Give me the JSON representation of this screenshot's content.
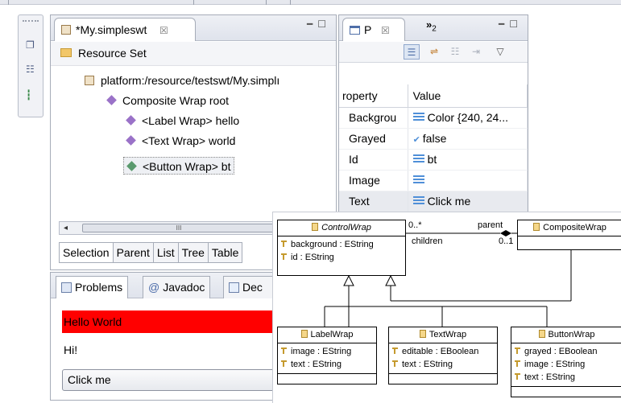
{
  "editor": {
    "tab_title": "*My.simpleswt",
    "close_symbol": "☒",
    "resource_set": "Resource Set",
    "tree": [
      {
        "label": "platform:/resource/testswt/My.simplı"
      },
      {
        "label": "Composite Wrap root"
      },
      {
        "label": "<Label Wrap> hello"
      },
      {
        "label": "<Text Wrap> world"
      },
      {
        "label": "<Button Wrap> bt"
      }
    ],
    "scroll_thumb": "III",
    "bottom_tabs": [
      "Selection",
      "Parent",
      "List",
      "Tree",
      "Table"
    ]
  },
  "properties": {
    "tab_label": "P",
    "close_symbol": "☒",
    "overflow_label": "»",
    "overflow_count": "2",
    "col_property": "roperty",
    "col_value": "Value",
    "rows": [
      {
        "property": "Backgrou",
        "value": "Color {240, 24..."
      },
      {
        "property": "Grayed",
        "value": "false"
      },
      {
        "property": "Id",
        "value": "bt"
      },
      {
        "property": "Image",
        "value": ""
      },
      {
        "property": "Text",
        "value": "Click me"
      }
    ]
  },
  "bottom_view": {
    "tabs": [
      "Problems",
      "Javadoc",
      "Dec"
    ],
    "hello_text": "Hello World",
    "hi_text": "Hi!",
    "button_text": "Click me",
    "hello_bg": "#ff0000"
  },
  "uml": {
    "control_wrap": {
      "name": "ControlWrap",
      "attrs": [
        "background : EString",
        "id : EString"
      ]
    },
    "composite_wrap": {
      "name": "CompositeWrap"
    },
    "label_wrap": {
      "name": "LabelWrap",
      "attrs": [
        "image : EString",
        "text : EString"
      ]
    },
    "text_wrap": {
      "name": "TextWrap",
      "attrs": [
        "editable : EBoolean",
        "text : EString"
      ]
    },
    "button_wrap": {
      "name": "ButtonWrap",
      "attrs": [
        "grayed : EBoolean",
        "image : EString",
        "text : EString"
      ]
    },
    "mult_children": "0..*",
    "role_parent": "parent",
    "role_children": "children",
    "mult_parent": "0..1"
  }
}
